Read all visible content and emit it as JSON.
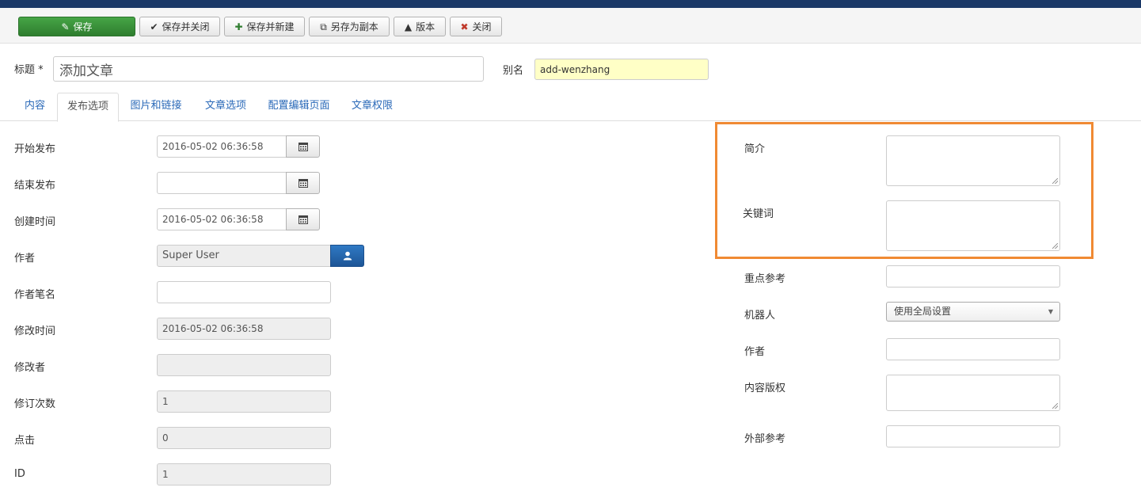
{
  "toolbar": {
    "save": "保存",
    "save_close": "保存并关闭",
    "save_new": "保存并新建",
    "save_copy": "另存为副本",
    "versions": "版本",
    "close": "关闭"
  },
  "header": {
    "title_label": "标题",
    "required_mark": "*",
    "title_value": "添加文章",
    "alias_label": "别名",
    "alias_value": "add-wenzhang"
  },
  "tabs": [
    {
      "label": "内容"
    },
    {
      "label": "发布选项"
    },
    {
      "label": "图片和链接"
    },
    {
      "label": "文章选项"
    },
    {
      "label": "配置编辑页面"
    },
    {
      "label": "文章权限"
    }
  ],
  "left_fields": {
    "publish_up": {
      "label": "开始发布",
      "value": "2016-05-02 06:36:58"
    },
    "publish_down": {
      "label": "结束发布",
      "value": ""
    },
    "created": {
      "label": "创建时间",
      "value": "2016-05-02 06:36:58"
    },
    "created_by": {
      "label": "作者",
      "value": "Super User"
    },
    "created_by_alias": {
      "label": "作者笔名",
      "value": ""
    },
    "modified": {
      "label": "修改时间",
      "value": "2016-05-02 06:36:58"
    },
    "modified_by": {
      "label": "修改者",
      "value": ""
    },
    "version": {
      "label": "修订次数",
      "value": "1"
    },
    "hits": {
      "label": "点击",
      "value": "0"
    },
    "id": {
      "label": "ID",
      "value": "1"
    }
  },
  "right_fields": {
    "metadesc": {
      "label": "简介"
    },
    "metakey": {
      "label": "关键词"
    },
    "xreference": {
      "label": "重点参考"
    },
    "robots": {
      "label": "机器人",
      "selected": "使用全局设置"
    },
    "author": {
      "label": "作者"
    },
    "rights": {
      "label": "内容版权"
    },
    "external_ref": {
      "label": "外部参考"
    }
  },
  "colors": {
    "topbar": "#1a3867",
    "save_green": "#46a546",
    "link_blue": "#2a69b8",
    "highlight_orange": "#f08a33",
    "alias_bg": "#ffffc6"
  }
}
